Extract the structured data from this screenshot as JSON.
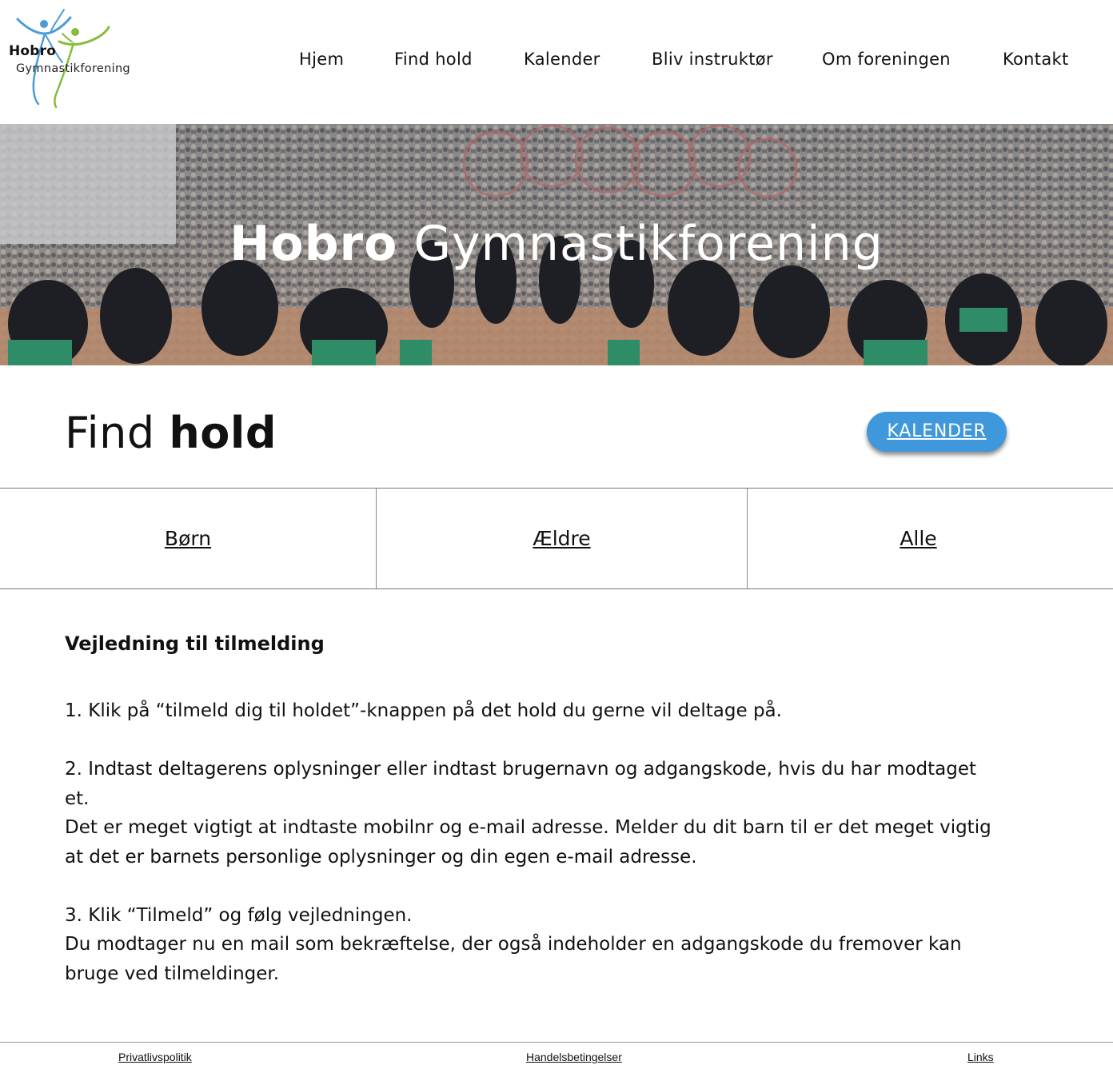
{
  "logo": {
    "line1": "Hobro",
    "line2": "Gymnastikforening",
    "colors": {
      "blue": "#4a9cd8",
      "green": "#86bd3c"
    }
  },
  "nav": {
    "items": [
      {
        "label": "Hjem"
      },
      {
        "label": "Find hold"
      },
      {
        "label": "Kalender"
      },
      {
        "label": "Bliv instruktør"
      },
      {
        "label": "Om foreningen"
      },
      {
        "label": "Kontakt"
      }
    ]
  },
  "hero": {
    "title_bold": "Hobro",
    "title_rest": " Gymnastikforening"
  },
  "section": {
    "title_light": "Find ",
    "title_bold": "hold",
    "button_label": "KALENDER",
    "button_color": "#3f97dc"
  },
  "tabs": [
    {
      "label": "Børn"
    },
    {
      "label": "Ældre"
    },
    {
      "label": "Alle"
    }
  ],
  "guide": {
    "title": "Vejledning til tilmelding",
    "step1": "1. Klik på “tilmeld dig til holdet”-knappen på det hold du gerne vil deltage på.",
    "step2_line1": "2. Indtast deltagerens oplysninger eller indtast brugernavn og adgangskode, hvis du har modtaget et.",
    "step2_line2": "Det er meget vigtigt at indtaste mobilnr og e-mail adresse. Melder du dit barn til er det meget vigtig at det er barnets personlige oplysninger og din egen e-mail adresse.",
    "step3_line1": "3. Klik “Tilmeld” og følg vejledningen.",
    "step3_line2": "Du modtager nu en mail som bekræftelse, der også indeholder en adgangskode du fremover kan bruge ved tilmeldinger."
  },
  "footer": {
    "links": [
      {
        "label": "Privatlivspolitik"
      },
      {
        "label": "Handelsbetingelser"
      },
      {
        "label": "Links"
      }
    ]
  }
}
